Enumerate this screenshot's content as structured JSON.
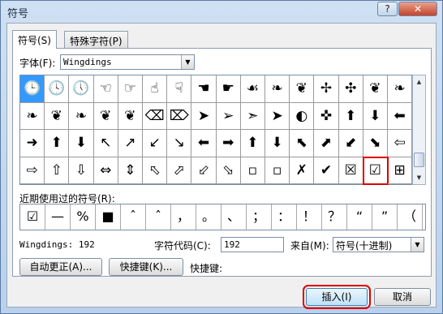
{
  "window": {
    "title": "符号",
    "help_label": "?",
    "close_label": "✕"
  },
  "tabs": [
    {
      "label": "符号(S)"
    },
    {
      "label": "特殊字符(P)"
    }
  ],
  "font": {
    "label": "字体(F):",
    "value": "Wingdings"
  },
  "symbol_grid": {
    "rows": [
      [
        "🕒",
        "🕓",
        "🕔",
        "☜",
        "☞",
        "☝",
        "☟",
        "☚",
        "☛",
        "☙",
        "❧",
        "❦",
        "✢",
        "✣",
        "❦",
        "❧"
      ],
      [
        "❧",
        "❦",
        "❧",
        "❦",
        "❦",
        "⌫",
        "⌦",
        "➤",
        "➢",
        "➣",
        "➤",
        "◐",
        "✜",
        "⬆",
        "⬇",
        "⬅"
      ],
      [
        "➜",
        "⬆",
        "⬇",
        "↖",
        "↗",
        "↙",
        "↘",
        "⬅",
        "➡",
        "⬆",
        "⬇",
        "⬉",
        "⬈",
        "⬋",
        "⬊",
        "⇦"
      ],
      [
        "⇨",
        "⇧",
        "⇩",
        "⇔",
        "⇕",
        "⬁",
        "⬀",
        "⬃",
        "⬂",
        "▫",
        "▫",
        "✗",
        "✔",
        "☒",
        "☑",
        "⊞"
      ]
    ],
    "selected": {
      "row": 0,
      "col": 0
    },
    "highlighted": {
      "row": 3,
      "col": 14
    }
  },
  "recent": {
    "label": "近期使用过的符号(R):",
    "symbols": [
      "☑",
      "—",
      "%",
      "■",
      "ˆ",
      "ˆ",
      "，",
      "。",
      "、",
      "；",
      "：",
      "！",
      "？",
      "“",
      "”",
      "（"
    ]
  },
  "info": {
    "font_code_text": "Wingdings: 192",
    "char_code_label": "字符代码(C):",
    "char_code_value": "192",
    "from_label": "来自(M):",
    "from_value": "符号(十进制)",
    "shortcut_label": "快捷键:"
  },
  "buttons": {
    "autocorrect": "自动更正(A)...",
    "shortcut_key": "快捷键(K)...",
    "insert": "插入(I)",
    "cancel": "取消"
  },
  "colors": {
    "selection": "#3399ff",
    "highlight_box": "#dd0000"
  }
}
